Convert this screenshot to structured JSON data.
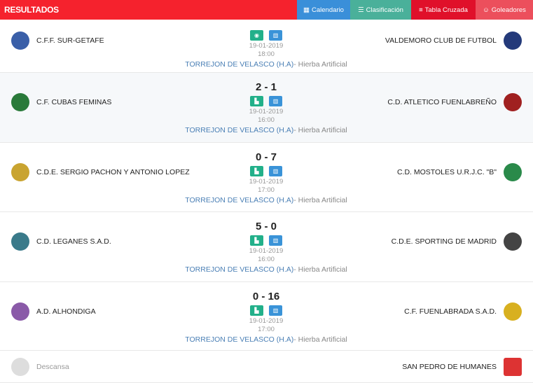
{
  "header": {
    "title": "RESULTADOS",
    "tabs": [
      {
        "label": "Calendario",
        "icon": "calendar-icon"
      },
      {
        "label": "Clasificación",
        "icon": "list-icon"
      },
      {
        "label": "Tabla Cruzada",
        "icon": "table-icon"
      },
      {
        "label": "Goleadores",
        "icon": "smile-icon"
      }
    ]
  },
  "matches": [
    {
      "home": "C.F.F. SUR-GETAFE",
      "away": "VALDEMORO CLUB DE FUTBOL",
      "score": "",
      "date": "19-01-2019",
      "time": "18:00",
      "venue": "TORREJON DE VELASCO (H.A)",
      "surface": "- Hierba Artificial",
      "first_icon": "eye-icon"
    },
    {
      "home": "C.F. CUBAS FEMINAS",
      "away": "C.D. ATLETICO FUENLABREÑO",
      "score": "2 - 1",
      "date": "19-01-2019",
      "time": "16:00",
      "venue": "TORREJON DE VELASCO (H.A)",
      "surface": "- Hierba Artificial",
      "first_icon": "document-icon"
    },
    {
      "home": "C.D.E. SERGIO PACHON Y ANTONIO LOPEZ",
      "away": "C.D. MOSTOLES U.R.J.C. \"B\"",
      "score": "0 - 7",
      "date": "19-01-2019",
      "time": "17:00",
      "venue": "TORREJON DE VELASCO (H.A)",
      "surface": "- Hierba Artificial",
      "first_icon": "document-icon"
    },
    {
      "home": "C.D. LEGANES S.A.D.",
      "away": "C.D.E. SPORTING DE MADRID",
      "score": "5 - 0",
      "date": "19-01-2019",
      "time": "16:00",
      "venue": "TORREJON DE VELASCO (H.A)",
      "surface": "- Hierba Artificial",
      "first_icon": "document-icon"
    },
    {
      "home": "A.D. ALHONDIGA",
      "away": "C.F. FUENLABRADA S.A.D.",
      "score": "0 - 16",
      "date": "19-01-2019",
      "time": "17:00",
      "venue": "TORREJON DE VELASCO (H.A)",
      "surface": "- Hierba Artificial",
      "first_icon": "document-icon"
    }
  ],
  "rest": {
    "label": "Descansa",
    "team": "SAN PEDRO DE HUMANES"
  },
  "colors": {
    "header": "#f5222d",
    "calendar": "#3a8fd9",
    "clasificacion": "#4ab09a",
    "tabla": "#e0102a",
    "goleadores": "#ec4f5c"
  }
}
